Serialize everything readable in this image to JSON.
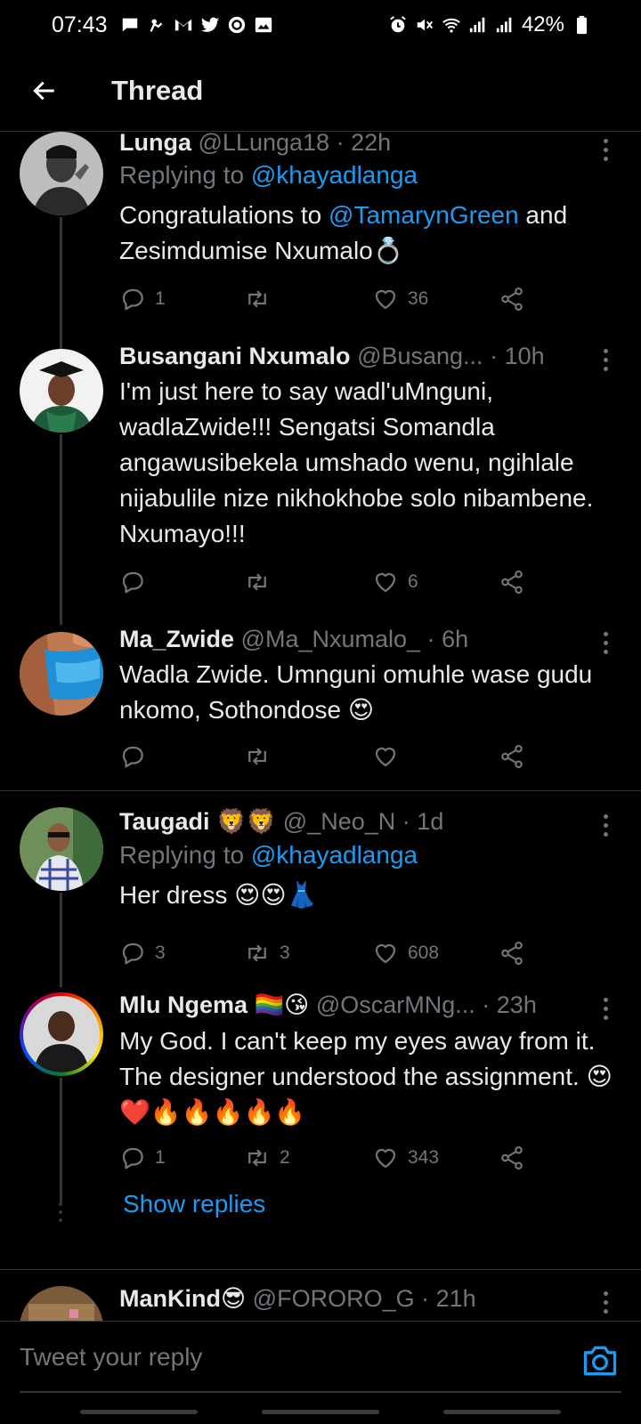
{
  "status_bar": {
    "time": "07:43",
    "battery": "42%",
    "left_icons": [
      "message-icon",
      "notification-icon",
      "gmail-icon",
      "twitter-icon",
      "app-icon",
      "gallery-icon"
    ],
    "right_icons": [
      "alarm-icon",
      "mute-icon",
      "wifi-icon",
      "signal-icon",
      "signal-icon",
      "battery-icon"
    ]
  },
  "header": {
    "title": "Thread"
  },
  "colors": {
    "accent": "#1d9bf0",
    "muted": "#71767b",
    "background": "#000000",
    "text": "#e7e9ea"
  },
  "tweets": [
    {
      "name": "Lunga",
      "handle": "@LLunga18",
      "time": "22h",
      "replying_label": "Replying to",
      "replying_to": "@khayadlanga",
      "text_parts": [
        "Congratulations to ",
        "@TamarynGreen",
        " and Zesimdumise Nxumalo",
        "💍"
      ],
      "replies": "1",
      "retweets": "",
      "likes": "36"
    },
    {
      "name": "Busangani Nxumalo",
      "handle": "@Busang...",
      "time": "10h",
      "text": "I'm just here to say wadl'uMnguni, wadlaZwide!!! Sengatsi Somandla angawusibekela umshado wenu, ngihlale nijabulile nize nikhokhobe solo nibambene. Nxumayo!!!",
      "replies": "",
      "retweets": "",
      "likes": "6"
    },
    {
      "name": "Ma_Zwide",
      "handle": "@Ma_Nxumalo_",
      "time": "6h",
      "text": "Wadla Zwide. Umnguni omuhle wase gudu nkomo, Sothondose ",
      "text_emoji": "😍",
      "replies": "",
      "retweets": "",
      "likes": ""
    },
    {
      "name": "Taugadi",
      "name_emoji": "🦁🦁",
      "handle": "@_Neo_N",
      "time": "1d",
      "replying_label": "Replying to",
      "replying_to": "@khayadlanga",
      "text": "Her dress ",
      "text_emoji": "😍😍👗",
      "replies": "3",
      "retweets": "3",
      "likes": "608"
    },
    {
      "name": "Mlu Ngema",
      "name_emoji": "🏳️‍🌈😘",
      "handle": "@OscarMNg...",
      "time": "23h",
      "text": "My God. I can't keep my eyes away from it. The designer understood the assignment. ",
      "text_emoji": "😍❤️🔥🔥🔥🔥🔥",
      "replies": "1",
      "retweets": "2",
      "likes": "343",
      "show_replies": "Show replies"
    },
    {
      "name": "ManKind",
      "name_emoji": "😎",
      "handle": "@FORORO_G",
      "time": "21h"
    }
  ],
  "reply_bar": {
    "placeholder": "Tweet your reply"
  }
}
